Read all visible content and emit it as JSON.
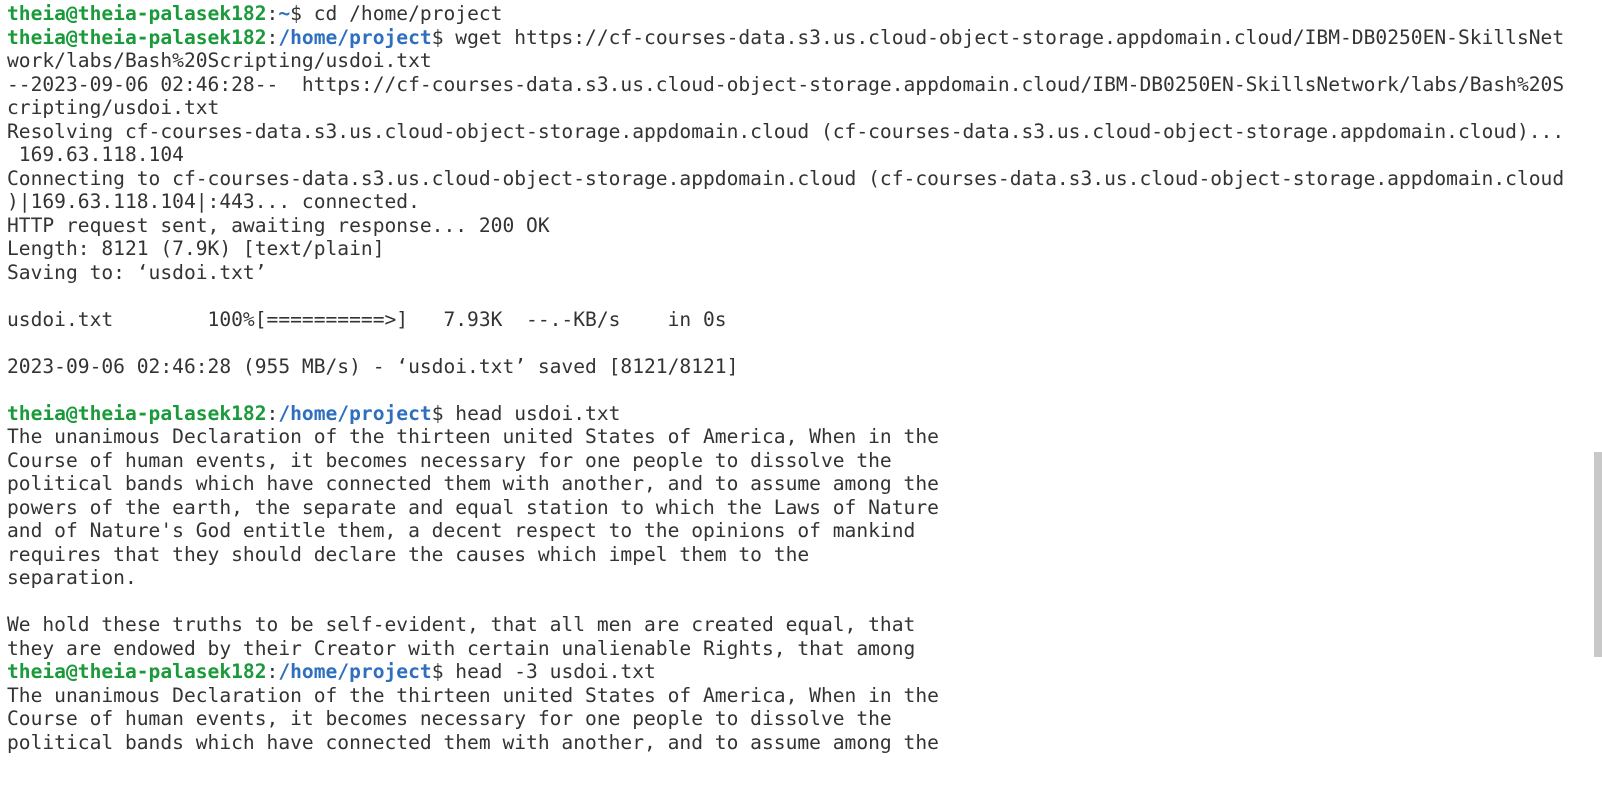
{
  "session": {
    "user_host": "theia@theia-palasek182",
    "home_prompt_path": "~",
    "project_prompt_path": "/home/project"
  },
  "lines": [
    {
      "kind": "prompt",
      "path": "~",
      "command": "cd /home/project"
    },
    {
      "kind": "prompt",
      "path": "/home/project",
      "command": "wget https://cf-courses-data.s3.us.cloud-object-storage.appdomain.cloud/IBM-DB0250EN-SkillsNet"
    },
    {
      "kind": "text",
      "text": "work/labs/Bash%20Scripting/usdoi.txt"
    },
    {
      "kind": "text",
      "text": "--2023-09-06 02:46:28--  https://cf-courses-data.s3.us.cloud-object-storage.appdomain.cloud/IBM-DB0250EN-SkillsNetwork/labs/Bash%20S"
    },
    {
      "kind": "text",
      "text": "cripting/usdoi.txt"
    },
    {
      "kind": "text",
      "text": "Resolving cf-courses-data.s3.us.cloud-object-storage.appdomain.cloud (cf-courses-data.s3.us.cloud-object-storage.appdomain.cloud)..."
    },
    {
      "kind": "text",
      "text": " 169.63.118.104"
    },
    {
      "kind": "text",
      "text": "Connecting to cf-courses-data.s3.us.cloud-object-storage.appdomain.cloud (cf-courses-data.s3.us.cloud-object-storage.appdomain.cloud"
    },
    {
      "kind": "text",
      "text": ")|169.63.118.104|:443... connected."
    },
    {
      "kind": "text",
      "text": "HTTP request sent, awaiting response... 200 OK"
    },
    {
      "kind": "text",
      "text": "Length: 8121 (7.9K) [text/plain]"
    },
    {
      "kind": "text",
      "text": "Saving to: ‘usdoi.txt’"
    },
    {
      "kind": "text",
      "text": ""
    },
    {
      "kind": "text",
      "text": "usdoi.txt        100%[==========>]   7.93K  --.-KB/s    in 0s"
    },
    {
      "kind": "text",
      "text": ""
    },
    {
      "kind": "text",
      "text": "2023-09-06 02:46:28 (955 MB/s) - ‘usdoi.txt’ saved [8121/8121]"
    },
    {
      "kind": "text",
      "text": ""
    },
    {
      "kind": "prompt",
      "path": "/home/project",
      "command": "head usdoi.txt"
    },
    {
      "kind": "text",
      "text": "The unanimous Declaration of the thirteen united States of America, When in the"
    },
    {
      "kind": "text",
      "text": "Course of human events, it becomes necessary for one people to dissolve the"
    },
    {
      "kind": "text",
      "text": "political bands which have connected them with another, and to assume among the"
    },
    {
      "kind": "text",
      "text": "powers of the earth, the separate and equal station to which the Laws of Nature"
    },
    {
      "kind": "text",
      "text": "and of Nature's God entitle them, a decent respect to the opinions of mankind"
    },
    {
      "kind": "text",
      "text": "requires that they should declare the causes which impel them to the"
    },
    {
      "kind": "text",
      "text": "separation."
    },
    {
      "kind": "text",
      "text": ""
    },
    {
      "kind": "text",
      "text": "We hold these truths to be self-evident, that all men are created equal, that"
    },
    {
      "kind": "text",
      "text": "they are endowed by their Creator with certain unalienable Rights, that among"
    },
    {
      "kind": "prompt",
      "path": "/home/project",
      "command": "head -3 usdoi.txt"
    },
    {
      "kind": "text",
      "text": "The unanimous Declaration of the thirteen united States of America, When in the"
    },
    {
      "kind": "text",
      "text": "Course of human events, it becomes necessary for one people to dissolve the"
    },
    {
      "kind": "text",
      "text": "political bands which have connected them with another, and to assume among the"
    }
  ],
  "colors": {
    "background": "#ffffff",
    "text": "#333333",
    "prompt_user": "#1a9a3a",
    "prompt_path": "#2f6fbf",
    "scrollbar_thumb": "#c8c8c8"
  }
}
